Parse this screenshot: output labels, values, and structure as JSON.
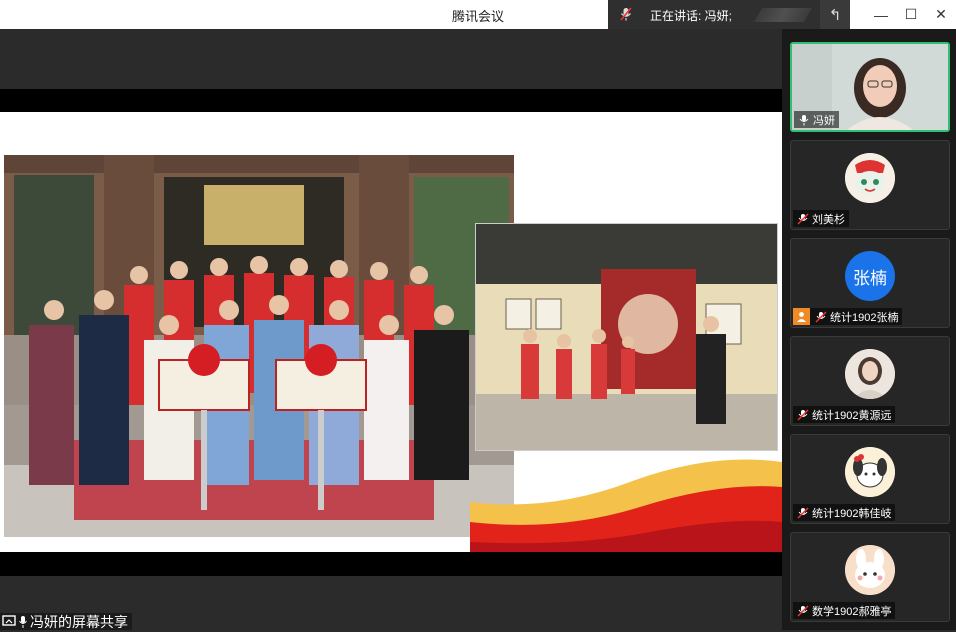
{
  "app": {
    "title": "腾讯会议"
  },
  "speaking": {
    "label": "正在讲话: 冯妍;"
  },
  "window_controls": {
    "minimize": "—",
    "maximize": "☐",
    "close": "✕",
    "back": "↰"
  },
  "share": {
    "label": "冯妍的屏幕共享"
  },
  "participants": [
    {
      "name": "冯妍",
      "avatar_text": "",
      "has_video": true,
      "mic": "on"
    },
    {
      "name": "刘美杉",
      "avatar_text": "",
      "mic": "off",
      "avatar_color": "#f5efe6"
    },
    {
      "name": "统计1902张楠",
      "avatar_text": "张楠",
      "mic": "off",
      "avatar_color": "#1a73e8",
      "host_badge": true
    },
    {
      "name": "统计1902黄源远",
      "avatar_text": "",
      "mic": "off",
      "avatar_color": "#e9e3dc"
    },
    {
      "name": "统计1902韩佳岐",
      "avatar_text": "",
      "mic": "off",
      "avatar_color": "#fbf1d8"
    },
    {
      "name": "数学1902郝雅亭",
      "avatar_text": "",
      "mic": "off",
      "avatar_color": "#f7dfc9"
    }
  ],
  "colors": {
    "active_border": "#2fbf71",
    "sidebar_bg": "#1a1a1a",
    "stage_bg": "#2b2b2b"
  }
}
